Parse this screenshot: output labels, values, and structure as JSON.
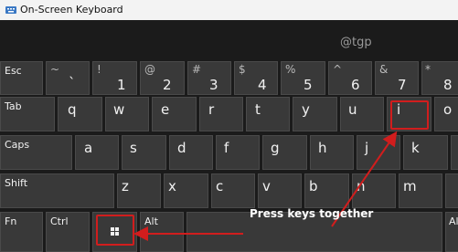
{
  "window": {
    "title": "On-Screen Keyboard",
    "app_icon": "keyboard-icon"
  },
  "watermark": "@tgp",
  "annotation": {
    "text": "Press keys together",
    "color": "#d11d1d"
  },
  "keys": {
    "esc": "Esc",
    "tilde": {
      "shift": "~",
      "main": "`"
    },
    "k1": {
      "shift": "!",
      "main": "1"
    },
    "k2": {
      "shift": "@",
      "main": "2"
    },
    "k3": {
      "shift": "#",
      "main": "3"
    },
    "k4": {
      "shift": "$",
      "main": "4"
    },
    "k5": {
      "shift": "%",
      "main": "5"
    },
    "k6": {
      "shift": "^",
      "main": "6"
    },
    "k7": {
      "shift": "&",
      "main": "7"
    },
    "k8": {
      "shift": "*",
      "main": "8"
    },
    "tab": "Tab",
    "q": "q",
    "w": "w",
    "e": "e",
    "r": "r",
    "t": "t",
    "y": "y",
    "u": "u",
    "i": "i",
    "o": "o",
    "caps": "Caps",
    "a": "a",
    "s": "s",
    "d": "d",
    "f": "f",
    "g": "g",
    "h": "h",
    "j": "j",
    "k": "k",
    "shift": "Shift",
    "z": "z",
    "x": "x",
    "c": "c",
    "v": "v",
    "b": "b",
    "n": "n",
    "m": "m",
    "fn": "Fn",
    "ctrl": "Ctrl",
    "win": "windows-logo-icon",
    "alt": "Alt",
    "altgr_partial": "Al"
  }
}
